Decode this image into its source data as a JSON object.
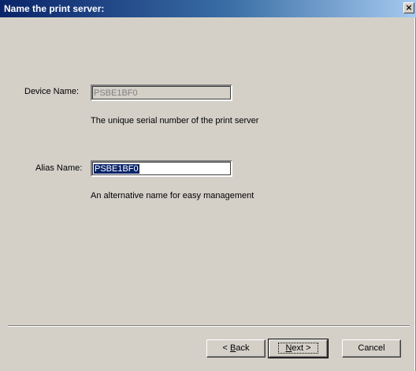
{
  "dialog": {
    "title": "Name the print server:",
    "close_symbol": "×"
  },
  "device": {
    "label": "Device Name:",
    "value": "PSBE1BF0",
    "description": "The unique serial number of the print server"
  },
  "alias": {
    "label": "Alias Name:",
    "value": "PSBE1BF0",
    "description": "An alternative name for easy management"
  },
  "buttons": {
    "back_prefix": "< ",
    "back_accel": "B",
    "back_rest": "ack",
    "next_accel": "N",
    "next_rest": "ext >",
    "cancel": "Cancel"
  },
  "icons": {
    "close": "close-icon"
  }
}
